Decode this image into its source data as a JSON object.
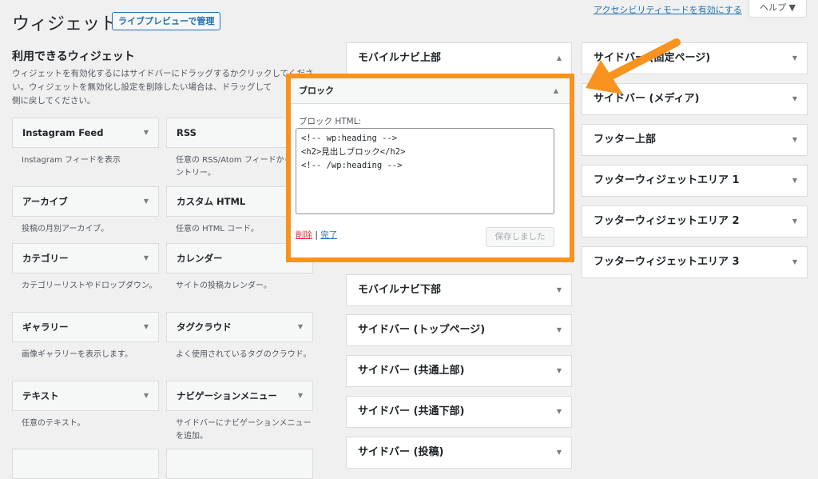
{
  "header": {
    "title": "ウィジェット",
    "live_preview": "ライブプレビューで管理",
    "accessibility_link": "アクセシビリティモードを有効にする",
    "help": "ヘルプ ▼"
  },
  "available": {
    "title": "利用できるウィジェット",
    "description": "ウィジェットを有効化するにはサイドバーにドラッグするかクリックしてください。ウィジェットを無効化し設定を削除したい場合は、ドラッグして\n側に戻してください。",
    "widgets": [
      {
        "name": "Instagram Feed",
        "desc": "Instagram フィードを表示"
      },
      {
        "name": "RSS",
        "desc": "任意の RSS/Atom フィードからのエントリー。"
      },
      {
        "name": "アーカイブ",
        "desc": "投稿の月別アーカイブ。"
      },
      {
        "name": "カスタム HTML",
        "desc": "任意の HTML コード。"
      },
      {
        "name": "カテゴリー",
        "desc": "カテゴリーリストやドロップダウン。"
      },
      {
        "name": "カレンダー",
        "desc": "サイトの投稿カレンダー。"
      },
      {
        "name": "ギャラリー",
        "desc": "画像ギャラリーを表示します。"
      },
      {
        "name": "タグクラウド",
        "desc": "よく使用されているタグのクラウド。"
      },
      {
        "name": "テキスト",
        "desc": "任意のテキスト。"
      },
      {
        "name": "ナビゲーションメニュー",
        "desc": "サイドバーにナビゲーションメニューを追加。"
      }
    ]
  },
  "middle_sidebars": [
    "モバイルナビ上部",
    "モバイルナビ下部",
    "サイドバー (トップページ)",
    "サイドバー (共通上部)",
    "サイドバー (共通下部)",
    "サイドバー (投稿)"
  ],
  "right_sidebars": [
    "サイドバー (固定ページ)",
    "サイドバー (メディア)",
    "フッター上部",
    "フッターウィジェットエリア 1",
    "フッターウィジェットエリア 2",
    "フッターウィジェットエリア 3"
  ],
  "block_widget": {
    "title": "ブロック",
    "field_label": "ブロック HTML:",
    "content": "<!-- wp:heading -->\n<h2>見出しブロック</h2>\n<!-- /wp:heading -->",
    "delete": "削除",
    "separator": "|",
    "done": "完了",
    "save": "保存しました"
  },
  "colors": {
    "highlight": "#f7931e",
    "link": "#2271b1",
    "delete": "#d63638"
  }
}
